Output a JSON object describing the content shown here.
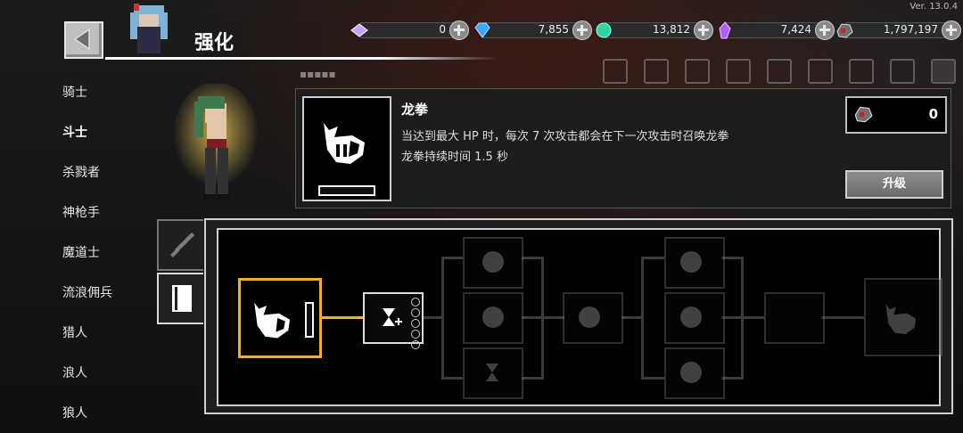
{
  "version": "Ver. 13.0.4",
  "header": {
    "title": "强化"
  },
  "currencies": [
    {
      "icon": "ticket-icon",
      "value": "0",
      "color": "#c9a0ff"
    },
    {
      "icon": "diamond-icon",
      "value": "7,855",
      "color": "#39a7ff"
    },
    {
      "icon": "soul-orb-icon",
      "value": "13,812",
      "color": "#2ed3a4"
    },
    {
      "icon": "crystal-icon",
      "value": "7,424",
      "color": "#b15cff"
    },
    {
      "icon": "ore-icon",
      "value": "1,797,197",
      "color": "#c02828"
    }
  ],
  "sidebar": {
    "items": [
      {
        "label": "骑士",
        "active": false
      },
      {
        "label": "斗士",
        "active": true
      },
      {
        "label": "杀戮者",
        "active": false
      },
      {
        "label": "神枪手",
        "active": false
      },
      {
        "label": "魔道士",
        "active": false
      },
      {
        "label": "流浪佣兵",
        "active": false
      },
      {
        "label": "猎人",
        "active": false
      },
      {
        "label": "浪人",
        "active": false
      },
      {
        "label": "狼人",
        "active": false
      }
    ]
  },
  "skill": {
    "title": "龙拳",
    "desc_line1": "当达到最大 HP 时，每次 7 次攻击都会在下一次攻击时召唤龙拳",
    "desc_line2": "龙拳持续时间 1.5 秒",
    "cost": "0",
    "upgrade_label": "升级"
  },
  "tabs": [
    {
      "icon": "sword-icon",
      "active": false
    },
    {
      "icon": "book-icon",
      "active": true
    }
  ],
  "colors": {
    "accent": "#f0b020",
    "panel_border": "#cfcfcf"
  }
}
